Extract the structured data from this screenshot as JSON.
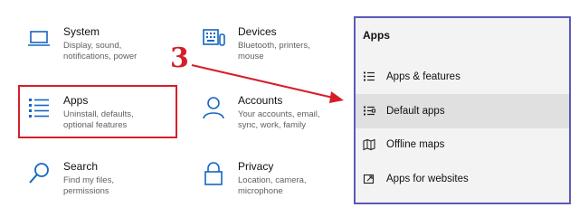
{
  "settings": {
    "tiles": [
      {
        "title": "System",
        "desc": "Display, sound, notifications, power",
        "icon": "laptop-icon"
      },
      {
        "title": "Devices",
        "desc": "Bluetooth, printers, mouse",
        "icon": "keyboard-icon"
      },
      {
        "title": "Apps",
        "desc": "Uninstall, defaults, optional features",
        "icon": "apps-list-icon"
      },
      {
        "title": "Accounts",
        "desc": "Your accounts, email, sync, work, family",
        "icon": "person-icon"
      },
      {
        "title": "Search",
        "desc": "Find my files, permissions",
        "icon": "search-icon"
      },
      {
        "title": "Privacy",
        "desc": "Location, camera, microphone",
        "icon": "lock-icon"
      }
    ]
  },
  "annotation": {
    "step_number": "3",
    "accent_color": "#d61e2a"
  },
  "apps_panel": {
    "header": "Apps",
    "border_color": "#5a5ab8",
    "items": [
      {
        "label": "Apps & features",
        "icon": "apps-features-icon"
      },
      {
        "label": "Default apps",
        "icon": "default-apps-icon",
        "selected": true
      },
      {
        "label": "Offline maps",
        "icon": "map-icon"
      },
      {
        "label": "Apps for websites",
        "icon": "open-external-icon"
      }
    ]
  }
}
